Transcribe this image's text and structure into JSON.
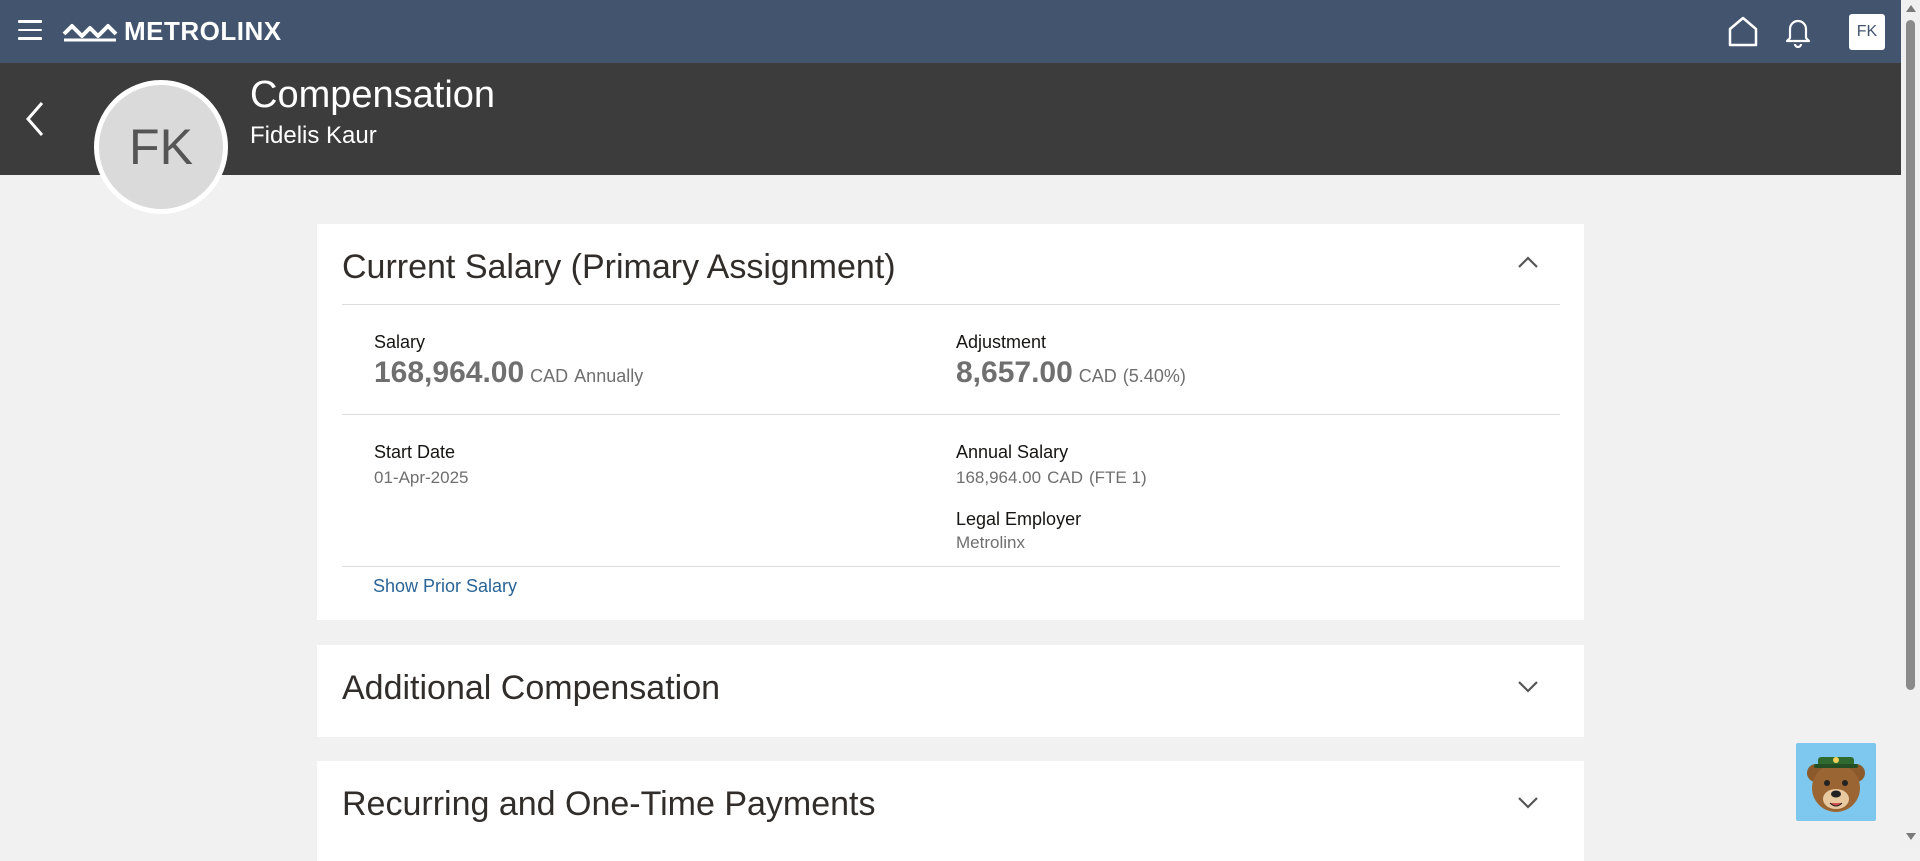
{
  "brand": {
    "name": "METROLINX"
  },
  "topbar": {
    "user_initials": "FK"
  },
  "header": {
    "title": "Compensation",
    "subtitle": "Fidelis Kaur",
    "avatar_initials": "FK"
  },
  "salary_card": {
    "title": "Current Salary (Primary Assignment)",
    "salary": {
      "label": "Salary",
      "amount": "168,964.00",
      "currency": "CAD",
      "frequency": "Annually"
    },
    "adjustment": {
      "label": "Adjustment",
      "amount": "8,657.00",
      "currency": "CAD",
      "percent": "(5.40%)"
    },
    "start_date": {
      "label": "Start Date",
      "value": "01-Apr-2025"
    },
    "annual_salary": {
      "label": "Annual Salary",
      "amount": "168,964.00",
      "currency": "CAD",
      "fte": "(FTE 1)"
    },
    "legal_employer": {
      "label": "Legal Employer",
      "value": "Metrolinx"
    },
    "link": "Show Prior Salary"
  },
  "additional_card": {
    "title": "Additional Compensation"
  },
  "recurring_card": {
    "title": "Recurring and One-Time Payments"
  },
  "colors": {
    "topbar": "#43546f",
    "header": "#3c3c3c",
    "link": "#2a6496"
  }
}
